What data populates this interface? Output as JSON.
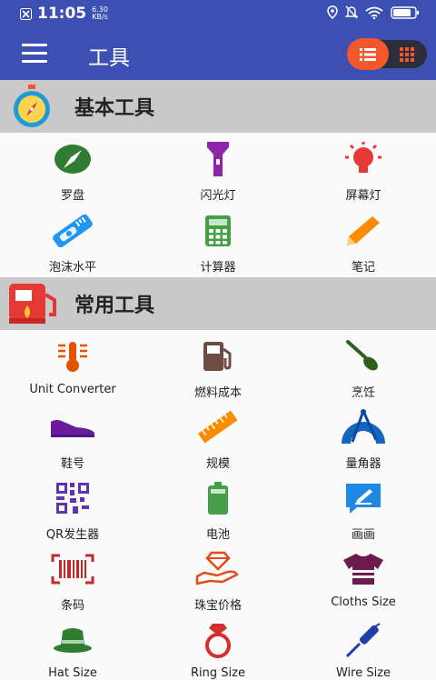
{
  "status": {
    "time": "11:05",
    "speed_value": "6.30",
    "speed_unit": "KB/s"
  },
  "appbar": {
    "title": "工具"
  },
  "sections": [
    {
      "title": "基本工具",
      "icon": "compass-stopwatch-icon",
      "tools": [
        {
          "label": "罗盘",
          "icon": "compass-icon",
          "color": "#2e7d32"
        },
        {
          "label": "闪光灯",
          "icon": "flashlight-icon",
          "color": "#8e24aa"
        },
        {
          "label": "屏幕灯",
          "icon": "bulb-icon",
          "color": "#e53935"
        },
        {
          "label": "泡沫水平",
          "icon": "bubble-level-icon",
          "color": "#2196f3"
        },
        {
          "label": "计算器",
          "icon": "calculator-icon",
          "color": "#43a047"
        },
        {
          "label": "笔记",
          "icon": "pencil-icon",
          "color": "#fb8c00"
        }
      ]
    },
    {
      "title": "常用工具",
      "icon": "fuel-pump-icon",
      "tools": [
        {
          "label": "Unit Converter",
          "icon": "thermometer-icon",
          "color": "#e65100"
        },
        {
          "label": "燃料成本",
          "icon": "gas-pump-icon",
          "color": "#6d4c41"
        },
        {
          "label": "烹饪",
          "icon": "spatula-icon",
          "color": "#2e5d1e"
        },
        {
          "label": "鞋号",
          "icon": "shoe-icon",
          "color": "#6a1b9a"
        },
        {
          "label": "规模",
          "icon": "ruler-icon",
          "color": "#fb8c00"
        },
        {
          "label": "量角器",
          "icon": "protractor-icon",
          "color": "#1565c0"
        },
        {
          "label": "QR发生器",
          "icon": "qr-code-icon",
          "color": "#5e35b1"
        },
        {
          "label": "电池",
          "icon": "battery-icon",
          "color": "#43a047"
        },
        {
          "label": "画画",
          "icon": "drawing-board-icon",
          "color": "#1e88e5"
        },
        {
          "label": "条码",
          "icon": "barcode-icon",
          "color": "#c62828"
        },
        {
          "label": "珠宝价格",
          "icon": "jewelry-hand-icon",
          "color": "#e64a19"
        },
        {
          "label": "Cloths Size",
          "icon": "tshirt-icon",
          "color": "#6d1b4e"
        },
        {
          "label": "Hat Size",
          "icon": "hat-icon",
          "color": "#2e7d32"
        },
        {
          "label": "Ring Size",
          "icon": "ring-icon",
          "color": "#d32f2f"
        },
        {
          "label": "Wire Size",
          "icon": "screwdriver-icon",
          "color": "#1e3fa8"
        }
      ]
    }
  ]
}
